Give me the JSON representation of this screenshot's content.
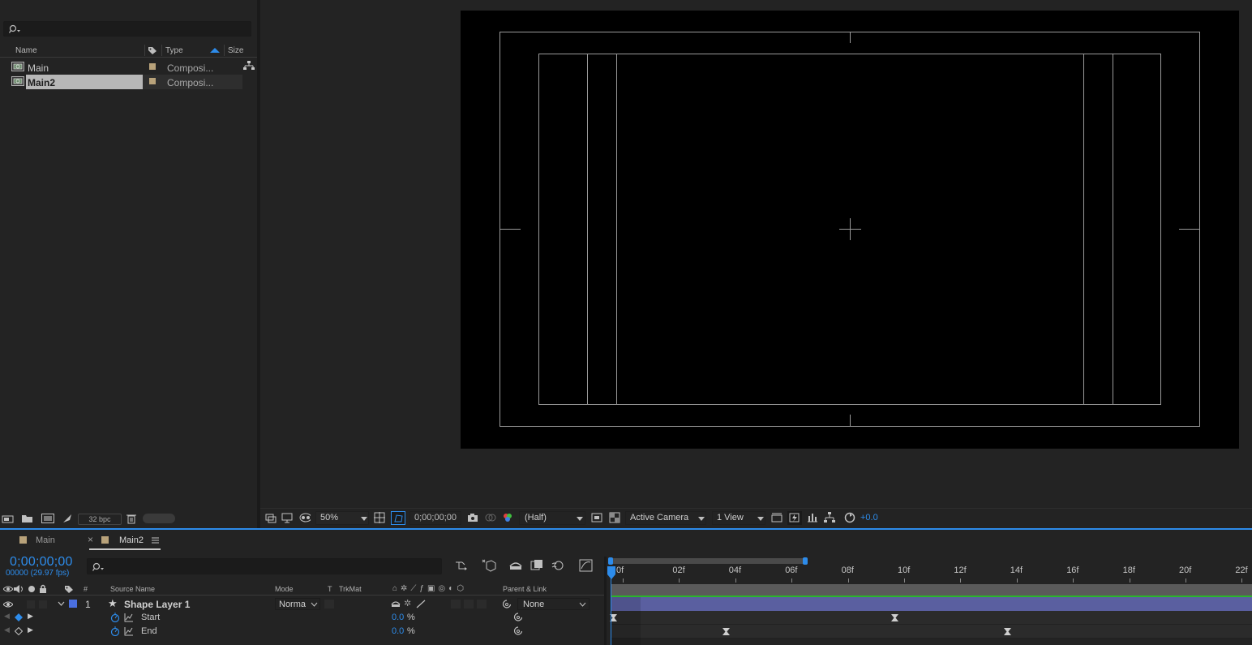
{
  "project": {
    "search_placeholder": "",
    "columns": {
      "name": "Name",
      "type": "Type",
      "size": "Size"
    },
    "items": [
      {
        "name": "Main",
        "type": "Composi...",
        "selected": false
      },
      {
        "name": "Main2",
        "type": "Composi...",
        "selected": true
      }
    ],
    "footer": {
      "bpc": "32 bpc"
    }
  },
  "viewer": {
    "zoom": "50%",
    "timecode": "0;00;00;00",
    "resolution": "(Half)",
    "camera": "Active Camera",
    "views": "1 View",
    "exposure": "+0.0"
  },
  "timeline": {
    "tabs": [
      {
        "label": "Main",
        "active": false
      },
      {
        "label": "Main2",
        "active": true
      }
    ],
    "current_time": "0;00;00;00",
    "fps_text": "00000 (29.97 fps)",
    "search_placeholder": "",
    "columns": {
      "hash": "#",
      "source_name": "Source Name",
      "mode": "Mode",
      "t": "T",
      "trkmat": "TrkMat",
      "parent": "Parent & Link"
    },
    "layer": {
      "index": "1",
      "name": "Shape Layer 1",
      "mode": "Norma",
      "parent": "None",
      "label_color": "#4a6fe0"
    },
    "properties": [
      {
        "name": "Start",
        "value": "0.0",
        "unit": "%"
      },
      {
        "name": "End",
        "value": "0.0",
        "unit": "%"
      }
    ],
    "ruler": [
      "0f",
      "02f",
      "04f",
      "06f",
      "08f",
      "10f",
      "12f",
      "14f",
      "16f",
      "18f",
      "20f",
      "22f"
    ]
  },
  "colors": {
    "accent": "#2d8ceb",
    "layer_bar": "#5a5fa0",
    "work_area": "#2ab52a",
    "swatch": "#b8a27a"
  }
}
